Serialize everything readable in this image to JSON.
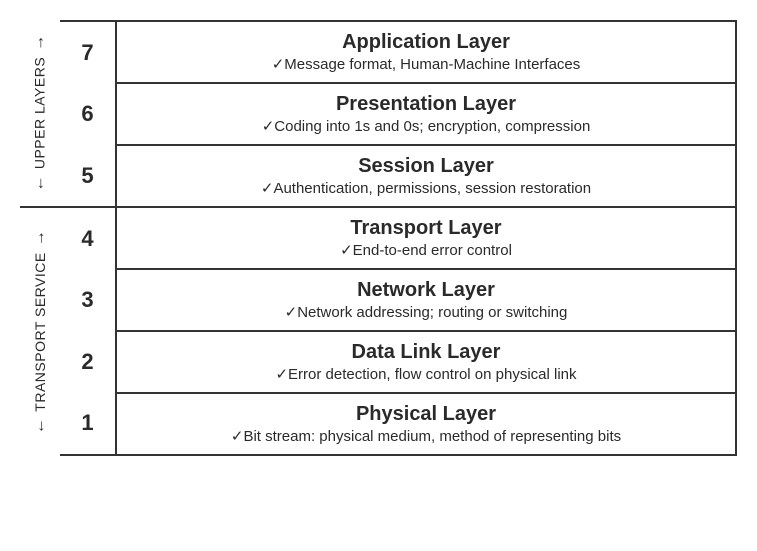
{
  "groups": [
    {
      "label": "UPPER LAYERS",
      "span": 3
    },
    {
      "label": "TRANSPORT SERVICE",
      "span": 4
    }
  ],
  "layers": [
    {
      "num": "7",
      "title": "Application Layer",
      "desc": "Message format, Human-Machine Interfaces"
    },
    {
      "num": "6",
      "title": "Presentation Layer",
      "desc": "Coding into 1s and 0s; encryption, compression"
    },
    {
      "num": "5",
      "title": "Session Layer",
      "desc": "Authentication, permissions, session restoration"
    },
    {
      "num": "4",
      "title": "Transport Layer",
      "desc": "End-to-end error control"
    },
    {
      "num": "3",
      "title": "Network Layer",
      "desc": "Network addressing; routing or switching"
    },
    {
      "num": "2",
      "title": "Data Link Layer",
      "desc": "Error detection, flow control on physical link"
    },
    {
      "num": "1",
      "title": "Physical Layer",
      "desc": "Bit stream: physical medium, method of representing bits"
    }
  ]
}
